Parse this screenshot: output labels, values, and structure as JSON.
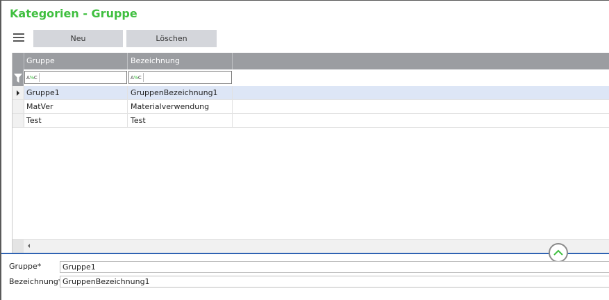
{
  "page": {
    "title": "Kategorien - Gruppe"
  },
  "toolbar": {
    "menu_icon": "hamburger-menu-icon",
    "new_label": "Neu",
    "delete_label": "Löschen"
  },
  "grid": {
    "columns": [
      "Gruppe",
      "Bezeichnung"
    ],
    "filter": {
      "operator_text": "A",
      "operator_pct": "%",
      "operator_suffix": "C",
      "icon": "filter-funnel-icon"
    },
    "rows": [
      {
        "gruppe": "Gruppe1",
        "bezeichnung": "GruppenBezeichnung1",
        "selected": true
      },
      {
        "gruppe": "MatVer",
        "bezeichnung": "Materialverwendung",
        "selected": false
      },
      {
        "gruppe": "Test",
        "bezeichnung": "Test",
        "selected": false
      }
    ]
  },
  "detail": {
    "gruppe_label": "Gruppe*",
    "gruppe_value": "Gruppe1",
    "bezeichnung_label": "Bezeichnung*",
    "bezeichnung_value": "GruppenBezeichnung1",
    "collapse_icon": "chevron-up-icon"
  },
  "colors": {
    "title": "#3fbf3f",
    "header": "#9b9da1",
    "selected_row": "#dde6f6",
    "splitter": "#2f63b3"
  }
}
